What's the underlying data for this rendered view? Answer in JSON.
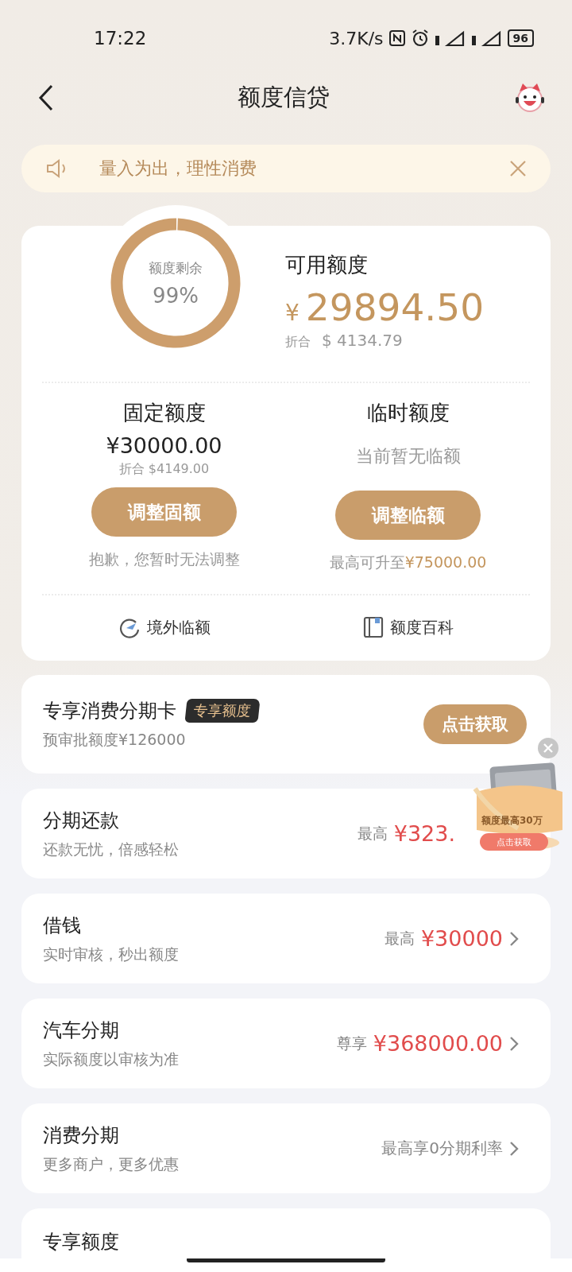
{
  "status_bar": {
    "time": "17:22",
    "speed": "3.7K/s",
    "battery": "96"
  },
  "header": {
    "title": "额度信贷"
  },
  "notice": {
    "text": "量入为出，理性消费"
  },
  "quota": {
    "ring_label": "额度剩余",
    "ring_value": "99%",
    "title": "可用额度",
    "currency": "¥",
    "amount": "29894.50",
    "converted_label": "折合",
    "converted": "$ 4134.79",
    "columns": [
      {
        "title": "固定额度",
        "amount": "¥30000.00",
        "note": "折合 $4149.00",
        "button": "调整固额",
        "hint": "抱歉，您暂时无法调整"
      },
      {
        "title": "临时额度",
        "note": "当前暂无临额",
        "button": "调整临额",
        "hint": "最高可升至",
        "hint_amount": "¥75000.00"
      }
    ],
    "links": [
      {
        "kind": "plane",
        "label": "境外临额"
      },
      {
        "kind": "book",
        "label": "额度百科"
      }
    ]
  },
  "promo_card": {
    "title": "专享消费分期卡",
    "badge": "专享额度",
    "subtitle": "预审批额度¥126000",
    "button": "点击获取"
  },
  "products": [
    {
      "title": "分期还款",
      "subtitle": "还款无忧，倍感轻松",
      "prefix": "最高",
      "value": "¥323.",
      "highlight": true,
      "chevron": false
    },
    {
      "title": "借钱",
      "subtitle": "实时审核，秒出额度",
      "prefix": "最高",
      "value": "¥30000",
      "highlight": true,
      "chevron": true
    },
    {
      "title": "汽车分期",
      "subtitle": "实际额度以审核为准",
      "prefix": "尊享",
      "value": "¥368000.00",
      "highlight": true,
      "chevron": true
    },
    {
      "title": "消费分期",
      "subtitle": "更多商户，更多优惠",
      "value": "最高享0分期利率",
      "highlight": false,
      "chevron": true
    },
    {
      "title": "专享额度"
    }
  ],
  "floating_ad": {
    "caption": "额度最高30万",
    "button": "点击获取"
  }
}
